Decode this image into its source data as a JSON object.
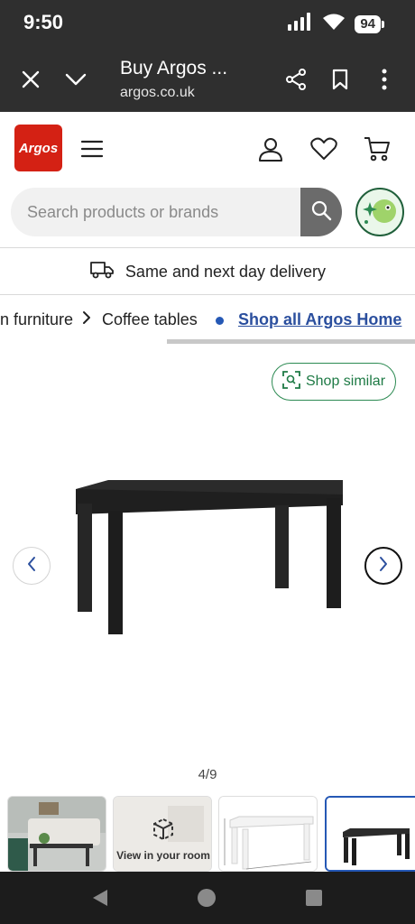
{
  "status": {
    "time": "9:50",
    "battery": "94"
  },
  "browser": {
    "title": "Buy Argos ...",
    "url": "argos.co.uk"
  },
  "header": {
    "logo_text": "Argos"
  },
  "search": {
    "placeholder": "Search products or brands"
  },
  "delivery": {
    "text": "Same and next day delivery"
  },
  "breadcrumb": {
    "items": [
      "n furniture",
      "Coffee tables"
    ],
    "separator": ">",
    "link": "Shop all Argos Home"
  },
  "product": {
    "shop_similar": "Shop similar",
    "counter": "4/9"
  },
  "thumbnails": {
    "view_in_room": "View in your room"
  },
  "colors": {
    "brand_red": "#d42114",
    "link_blue": "#2b4f9e",
    "accent_green": "#2c8a52",
    "dark_bar": "#2f2f2f"
  },
  "icons": [
    "close-icon",
    "chevron-down-icon",
    "share-icon",
    "bookmark-icon",
    "more-vert-icon",
    "menu-icon",
    "account-icon",
    "heart-icon",
    "cart-icon",
    "search-icon",
    "truck-icon",
    "chevron-right-icon",
    "chevron-left-icon",
    "scan-icon",
    "ar-cube-icon",
    "back-nav-icon",
    "home-nav-icon",
    "recents-nav-icon"
  ]
}
